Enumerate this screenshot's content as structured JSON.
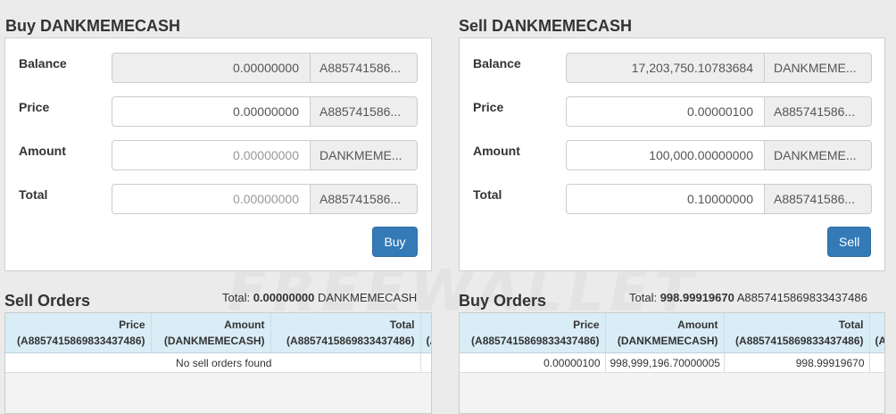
{
  "buy": {
    "title": "Buy DANKMEMECASH",
    "labels": {
      "balance": "Balance",
      "price": "Price",
      "amount": "Amount",
      "total": "Total"
    },
    "balance_value": "0.00000000",
    "balance_currency": "A885741586...",
    "price_value": "0.00000000",
    "price_currency": "A885741586...",
    "amount_placeholder": "0.00000000",
    "amount_currency": "DANKMEME...",
    "total_placeholder": "0.00000000",
    "total_currency": "A885741586...",
    "button_label": "Buy"
  },
  "sell": {
    "title": "Sell DANKMEMECASH",
    "labels": {
      "balance": "Balance",
      "price": "Price",
      "amount": "Amount",
      "total": "Total"
    },
    "balance_value": "17,203,750.10783684",
    "balance_currency": "DANKMEME...",
    "price_value": "0.00000100",
    "price_currency": "A885741586...",
    "amount_value": "100,000.00000000",
    "amount_currency": "DANKMEME...",
    "total_value": "0.10000000",
    "total_currency": "A885741586...",
    "button_label": "Sell"
  },
  "sell_orders": {
    "title": "Sell Orders",
    "total_label": "Total:",
    "total_value": "0.00000000",
    "total_unit": "DANKMEMECASH",
    "headers": [
      {
        "name": "Price",
        "unit": "(A8857415869833437486)"
      },
      {
        "name": "Amount",
        "unit": "(DANKMEMECASH)"
      },
      {
        "name": "Total",
        "unit": "(A8857415869833437486)"
      },
      {
        "name": "",
        "unit": "(A"
      }
    ],
    "empty_message": "No sell orders found"
  },
  "buy_orders": {
    "title": "Buy Orders",
    "total_label": "Total:",
    "total_value": "998.99919670",
    "total_unit": "A8857415869833437486",
    "headers": [
      {
        "name": "Price",
        "unit": "(A8857415869833437486)"
      },
      {
        "name": "Amount",
        "unit": "(DANKMEMECASH)"
      },
      {
        "name": "Total",
        "unit": "(A8857415869833437486)"
      },
      {
        "name": "",
        "unit": "(A"
      }
    ],
    "rows": [
      {
        "price": "0.00000100",
        "amount": "998,999,196.70000005",
        "total": "998.99919670"
      }
    ]
  }
}
